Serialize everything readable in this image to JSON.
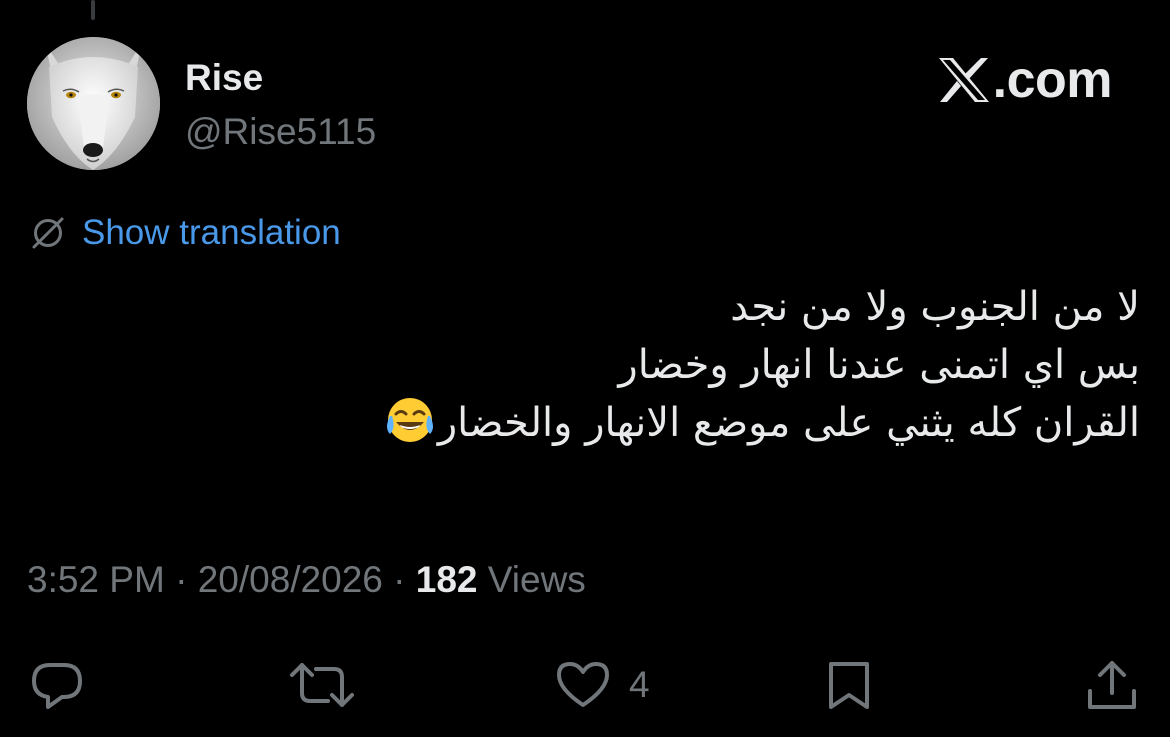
{
  "author": {
    "display_name": "Rise",
    "handle": "@Rise5115",
    "avatar_icon": "white-wolf-avatar"
  },
  "brand": {
    "label": ".com",
    "icon": "x-logo-icon"
  },
  "translation": {
    "icon": "globe-slash-icon",
    "label": "Show translation",
    "color": "#4a99e9"
  },
  "tweet": {
    "lines": [
      "لا من الجنوب ولا من نجد",
      "بس اي اتمنى عندنا انهار وخضار",
      "القران كله يثني على موضع الانهار والخضار"
    ],
    "trailing_emoji": "face-with-tears-of-joy"
  },
  "meta": {
    "time": "3:52 PM",
    "separator": " · ",
    "date": "20/08/2026",
    "views_count": "182",
    "views_label": "Views"
  },
  "actions": {
    "reply_icon": "reply-icon",
    "retweet_icon": "retweet-icon",
    "like_icon": "heart-icon",
    "like_count": "4",
    "bookmark_icon": "bookmark-icon",
    "share_icon": "share-icon"
  },
  "colors": {
    "background": "#000000",
    "primary_text": "#e7e9ea",
    "secondary_text": "#71767b",
    "link": "#4a99e9"
  }
}
